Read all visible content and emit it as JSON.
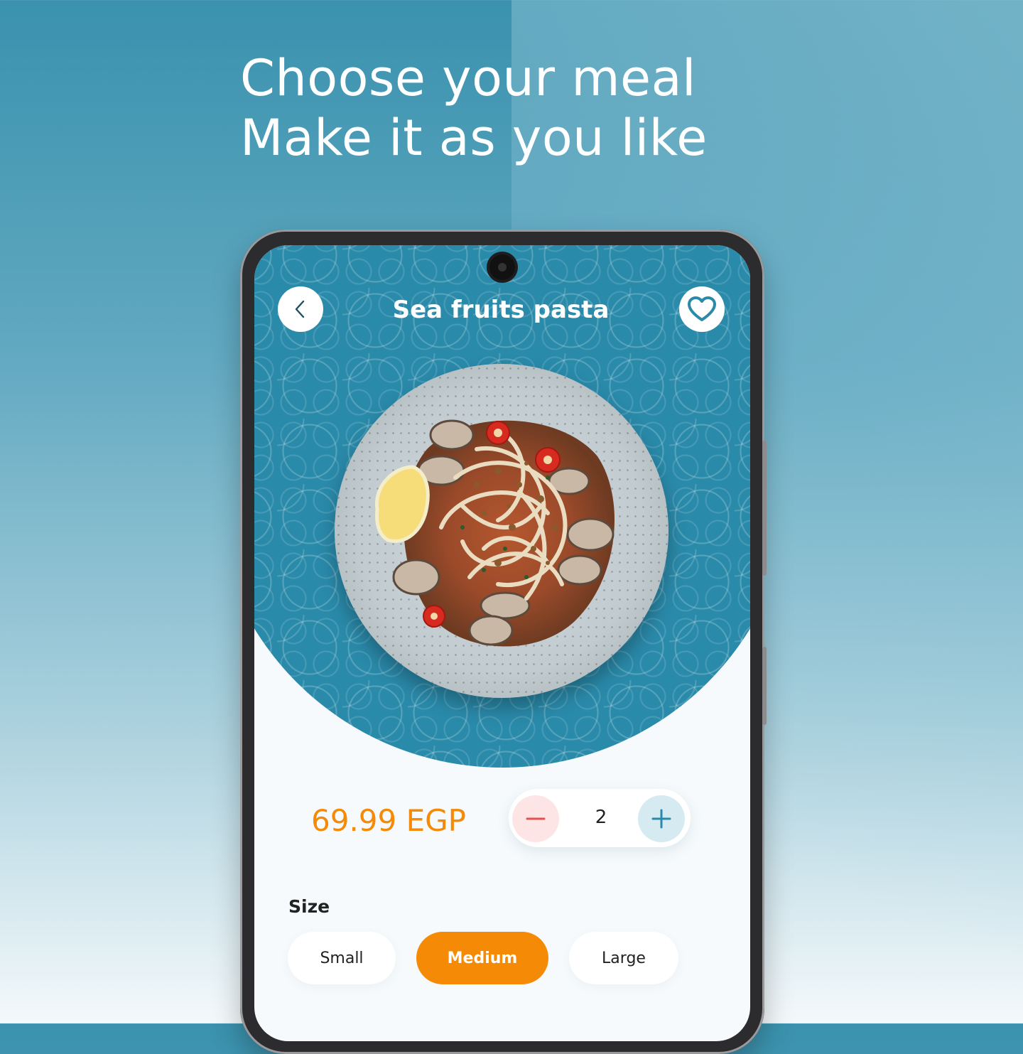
{
  "headline": {
    "line1": "Choose your meal",
    "line2": "Make it as you like"
  },
  "product": {
    "title": "Sea fruits pasta",
    "price": "69.99 EGP",
    "quantity": "2"
  },
  "icons": {
    "back": "chevron-left-icon",
    "favorite": "heart-icon",
    "decrease": "minus-icon",
    "increase": "plus-icon"
  },
  "size": {
    "label": "Size",
    "options": [
      "Small",
      "Medium",
      "Large"
    ],
    "selected": "Medium"
  },
  "colors": {
    "brand_blue": "#2a8aaa",
    "accent_orange": "#f58a07",
    "minus_bg": "#fde5e5",
    "minus_fg": "#e55050",
    "plus_bg": "#d6eaf1",
    "plus_fg": "#2a8aaa"
  }
}
